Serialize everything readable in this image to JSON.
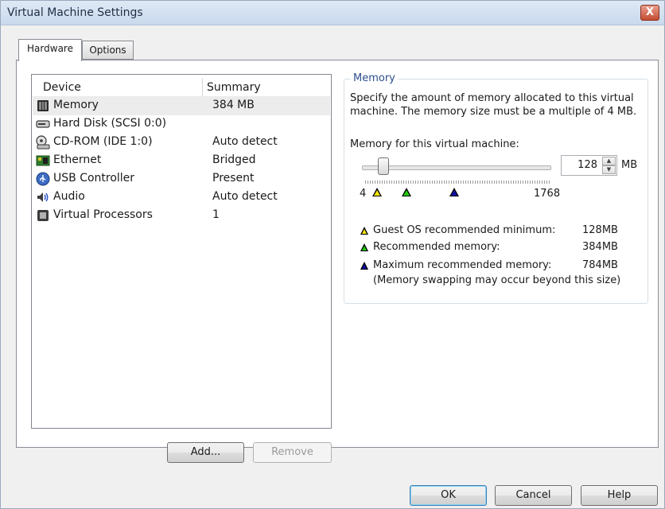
{
  "window": {
    "title": "Virtual Machine Settings",
    "close_label": "X"
  },
  "tabs": [
    {
      "label": "Hardware",
      "active": true
    },
    {
      "label": "Options",
      "active": false
    }
  ],
  "devices": {
    "col_device": "Device",
    "col_summary": "Summary",
    "rows": [
      {
        "name": "Memory",
        "summary": "384 MB",
        "icon": "memory-icon",
        "selected": true
      },
      {
        "name": "Hard Disk (SCSI 0:0)",
        "summary": "",
        "icon": "hard-disk-icon"
      },
      {
        "name": "CD-ROM (IDE 1:0)",
        "summary": "Auto detect",
        "icon": "cdrom-icon"
      },
      {
        "name": "Ethernet",
        "summary": "Bridged",
        "icon": "ethernet-icon"
      },
      {
        "name": "USB Controller",
        "summary": "Present",
        "icon": "usb-icon"
      },
      {
        "name": "Audio",
        "summary": "Auto detect",
        "icon": "audio-icon"
      },
      {
        "name": "Virtual Processors",
        "summary": "1",
        "icon": "processor-icon"
      }
    ]
  },
  "buttons": {
    "add": "Add...",
    "remove": "Remove",
    "ok": "OK",
    "cancel": "Cancel",
    "help": "Help"
  },
  "memory": {
    "group_title": "Memory",
    "description": "Specify the amount of memory allocated to this virtual machine. The memory size must be a multiple of 4 MB.",
    "label": "Memory for this virtual machine:",
    "value": "128",
    "unit": "MB",
    "slider_min": "4",
    "slider_max": "1768",
    "slider_position": 0.07,
    "markers": [
      {
        "color": "#f5e400",
        "position": 0.02
      },
      {
        "color": "#22cc00",
        "position": 0.18
      },
      {
        "color": "#1010a8",
        "position": 0.44
      }
    ],
    "legend": [
      {
        "color": "#f5e400",
        "label": "Guest OS recommended minimum:",
        "value": "128MB"
      },
      {
        "color": "#22cc00",
        "label": "Recommended memory:",
        "value": "384MB"
      },
      {
        "color": "#1010a8",
        "label": "Maximum recommended memory:",
        "value": "784MB"
      }
    ],
    "note": "(Memory swapping may occur beyond this size)"
  }
}
